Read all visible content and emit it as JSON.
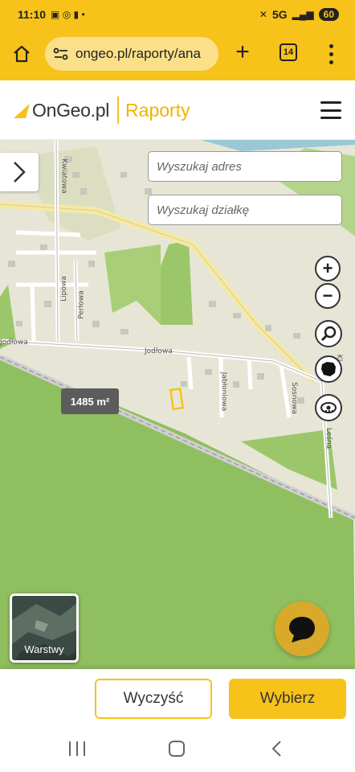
{
  "status_bar": {
    "time": "11:10",
    "network": "5G",
    "battery": "60"
  },
  "browser": {
    "url": "ongeo.pl/raporty/ana",
    "tab_count": "14"
  },
  "header": {
    "logo_text": "OnGeo.pl",
    "logo_sub": "Raporty"
  },
  "map": {
    "search_address_placeholder": "Wyszukaj adres",
    "search_plot_placeholder": "Wyszukaj działkę",
    "zoom_in": "+",
    "zoom_out": "−",
    "area_label": "1485 m²",
    "layers_label": "Warstwy",
    "streets": [
      "Kwiatowa",
      "Lipowa",
      "Perłowa",
      "Jodłowa",
      "Jodłowa",
      "Jabłoniowa",
      "Sosnowa",
      "Leśna",
      "Kl"
    ],
    "colors": {
      "forest": "#8fbf5e",
      "residential": "#e7e6d6",
      "road": "#f5e9a6",
      "accent": "#f7c21a"
    }
  },
  "footer": {
    "clear_label": "Wyczyść",
    "choose_label": "Wybierz"
  }
}
